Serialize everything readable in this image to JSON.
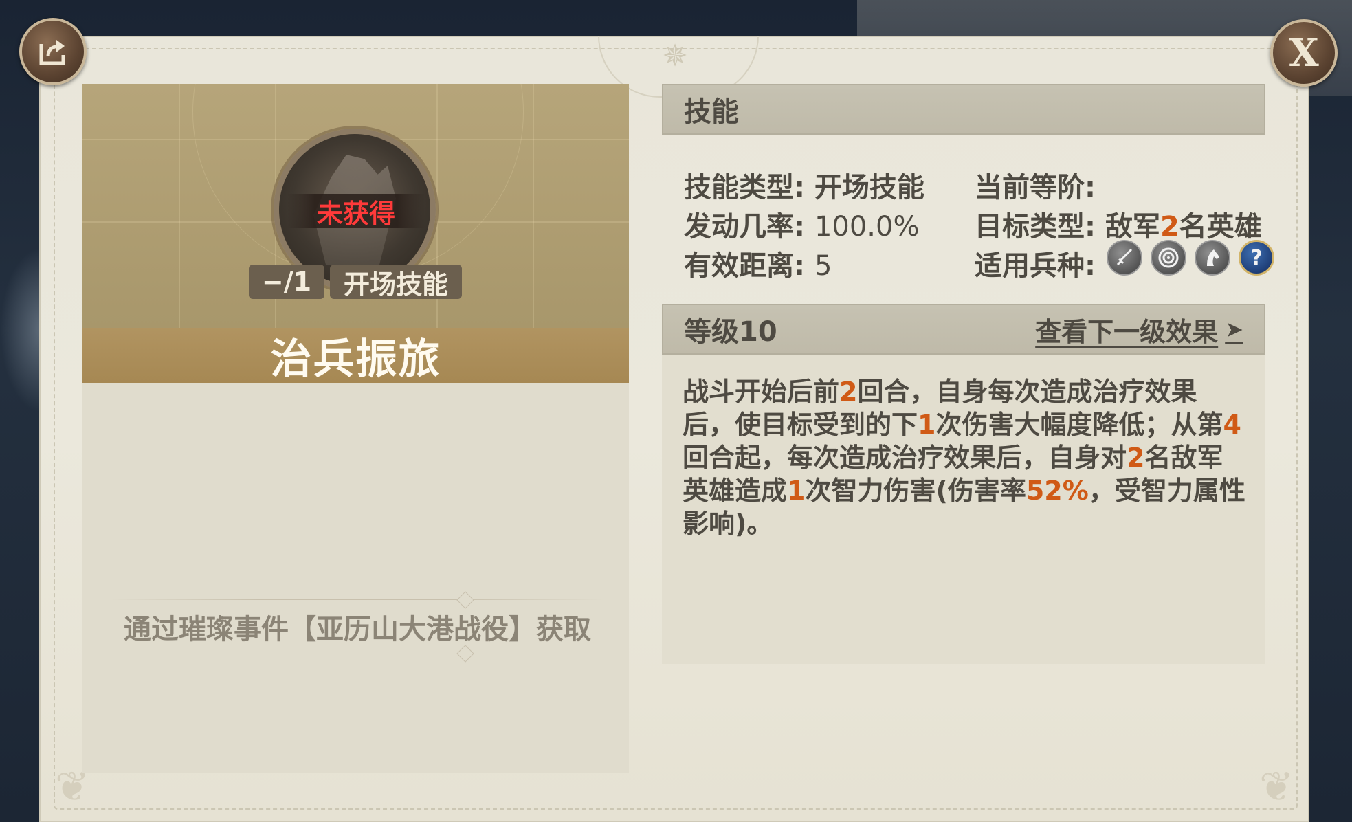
{
  "header": {
    "share_icon": "share-icon",
    "close_label": "X"
  },
  "card": {
    "status": "未获得",
    "level_tag": "−/1",
    "type_tag": "开场技能",
    "name": "治兵振旅",
    "source": "通过璀璨事件【亚历山大港战役】获取"
  },
  "skill": {
    "section_title": "技能",
    "type_label": "技能类型:",
    "type_value": "开场技能",
    "rate_label": "发动几率:",
    "rate_value": "100.0%",
    "range_label": "有效距离:",
    "range_value": "5",
    "rank_label": "当前等阶:",
    "rank_value": "",
    "target_label": "目标类型:",
    "target_prefix": "敌军",
    "target_count": "2",
    "target_suffix": "名英雄",
    "units_label": "适用兵种:",
    "unit_icons": [
      "sword-icon",
      "target-icon",
      "horse-icon",
      "help-icon"
    ],
    "help_glyph": "?"
  },
  "level": {
    "title": "等级10",
    "next_link": "查看下一级效果",
    "next_arrow": "➤"
  },
  "description": {
    "segments": [
      {
        "text": "战斗开始后前",
        "highlight": false
      },
      {
        "text": "2",
        "highlight": true
      },
      {
        "text": "回合，自身每次造成治疗效果后，使目标受到的下",
        "highlight": false
      },
      {
        "text": "1",
        "highlight": true
      },
      {
        "text": "次伤害大幅度降低；从第",
        "highlight": false
      },
      {
        "text": "4",
        "highlight": true
      },
      {
        "text": "回合起，每次造成治疗效果后，自身对",
        "highlight": false
      },
      {
        "text": "2",
        "highlight": true
      },
      {
        "text": "名敌军英雄造成",
        "highlight": false
      },
      {
        "text": "1",
        "highlight": true
      },
      {
        "text": "次智力伤害(伤害率",
        "highlight": false
      },
      {
        "text": "52%",
        "highlight": true
      },
      {
        "text": "，受智力属性影响)。",
        "highlight": false
      }
    ]
  },
  "colors": {
    "highlight": "#d05a16",
    "status_red": "#ff3a3a",
    "name_bar": "#a68853"
  }
}
